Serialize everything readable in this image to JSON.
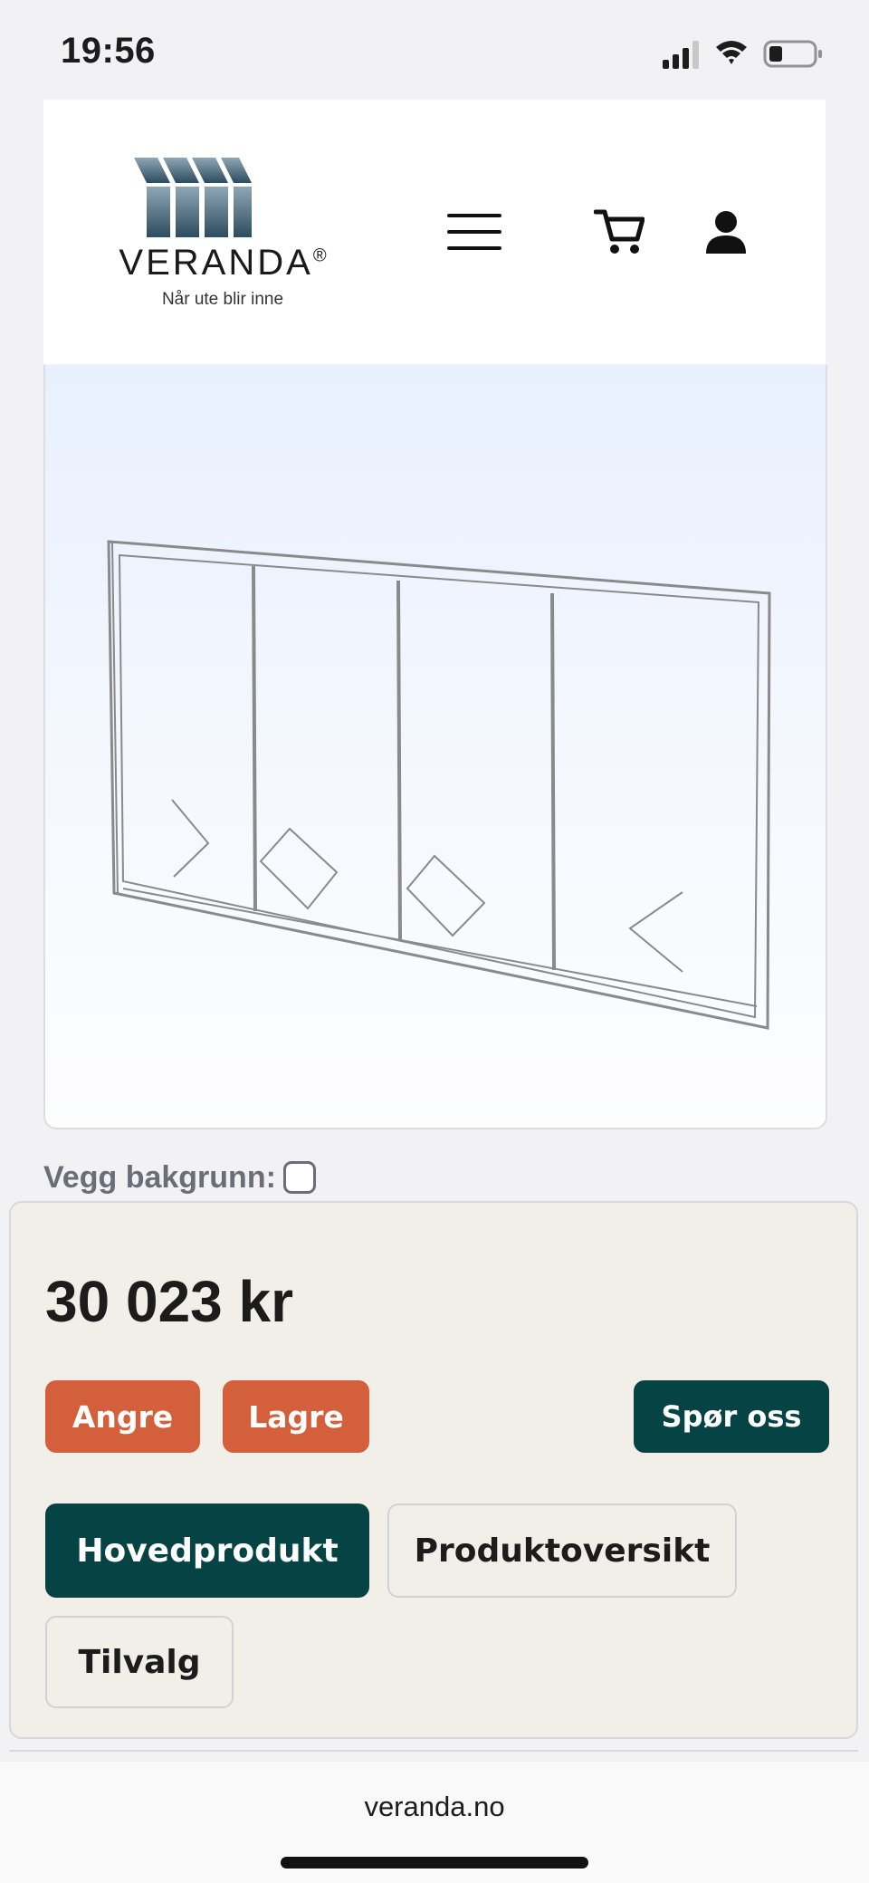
{
  "status_bar": {
    "time": "19:56",
    "icons": [
      "signal-icon",
      "wifi-icon",
      "battery-icon"
    ]
  },
  "header": {
    "brand": "VERANDA",
    "brand_mark": "®",
    "tagline": "Når ute blir inne",
    "icons": [
      "menu-icon",
      "cart-icon",
      "user-icon"
    ]
  },
  "viewer": {
    "wall_background_label": "Vegg bakgrunn:",
    "wall_background_checked": false
  },
  "config_panel": {
    "price": "30 023 kr",
    "undo_label": "Angre",
    "save_label": "Lagre",
    "ask_label": "Spør oss",
    "tabs": [
      {
        "label": "Hovedprodukt",
        "active": true
      },
      {
        "label": "Produktoversikt",
        "active": false
      },
      {
        "label": "Tilvalg",
        "active": false
      }
    ]
  },
  "browser": {
    "url": "veranda.no"
  },
  "colors": {
    "accent_dark": "#064345",
    "accent_orange": "#d4603b",
    "panel_bg": "#f2efe9"
  }
}
